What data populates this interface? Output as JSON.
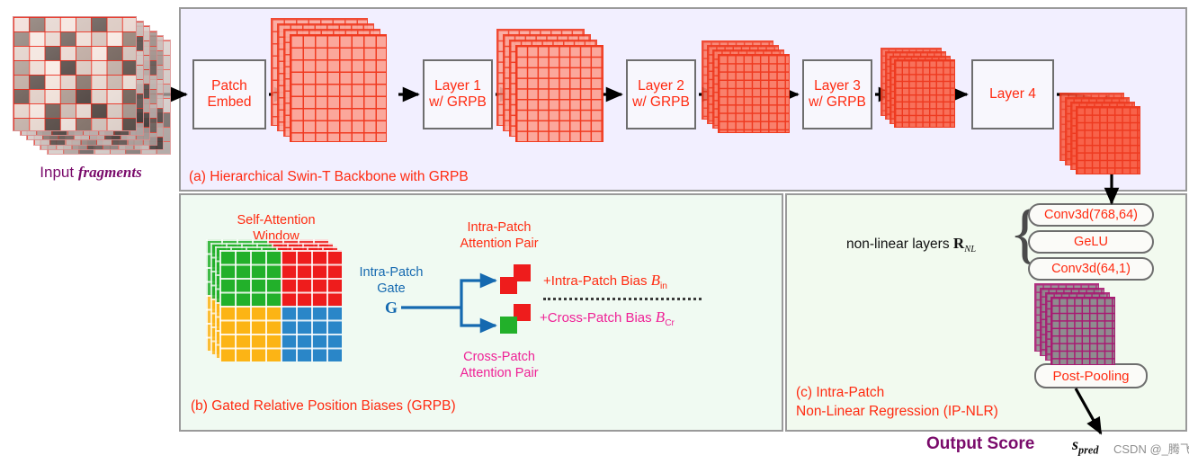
{
  "figure": {
    "input_label_prefix": "Input ",
    "input_label_em": "fragments",
    "output_label": "Output Score",
    "output_symbol_base": "s",
    "output_symbol_sub": "pred",
    "watermark": "CSDN @_腾飞"
  },
  "panel_a": {
    "caption": "(a) Hierarchical Swin-T Backbone with GRPB",
    "blocks": [
      {
        "line1": "Patch",
        "line2": "Embed"
      },
      {
        "line1": "Layer 1",
        "line2": "w/ GRPB"
      },
      {
        "line1": "Layer 2",
        "line2": "w/ GRPB"
      },
      {
        "line1": "Layer 3",
        "line2": "w/ GRPB"
      },
      {
        "line1": "Layer 4",
        "line2": ""
      }
    ]
  },
  "panel_b": {
    "caption": "(b) Gated Relative Position Biases (GRPB)",
    "window_label_l1": "Self-Attention",
    "window_label_l2": "Window",
    "gate_label_l1": "Intra-Patch",
    "gate_label_l2": "Gate",
    "gate_symbol": "G",
    "intra_pair_l1": "Intra-Patch",
    "intra_pair_l2": "Attention Pair",
    "cross_pair_l1": "Cross-Patch",
    "cross_pair_l2": "Attention Pair",
    "intra_bias_text": "+Intra-Patch Bias ",
    "intra_bias_sym": "B",
    "intra_bias_sub": "in",
    "cross_bias_text": "+Cross-Patch Bias ",
    "cross_bias_sym": "B",
    "cross_bias_sub": "Cr",
    "quadrant_colors": {
      "top_left": "#22b02a",
      "top_right": "#ee1c1c",
      "bottom_left": "#fcb415",
      "bottom_right": "#2a86c8"
    }
  },
  "panel_c": {
    "caption_l1": "(c) Intra-Patch",
    "caption_l2": "Non-Linear Regression (IP-NLR)",
    "nl_label": "non-linear layers ",
    "nl_symbol": "R",
    "nl_symbol_sub": "NL",
    "layers": [
      "Conv3d(768,64)",
      "GeLU",
      "Conv3d(64,1)"
    ],
    "post_pooling": "Post-Pooling"
  },
  "colors": {
    "panel_a_bg": "#f2efff",
    "panel_b_bg": "#f0faf2",
    "panel_c_bg": "#f2faef",
    "box_border": "#6e6e6e",
    "label_red": "#ff2a10",
    "label_pink": "#ef2196",
    "label_purple": "#7a0b6b",
    "gate_blue": "#1569b0",
    "feature_red": "#f4553f",
    "pool_magenta": "#a81a72"
  }
}
